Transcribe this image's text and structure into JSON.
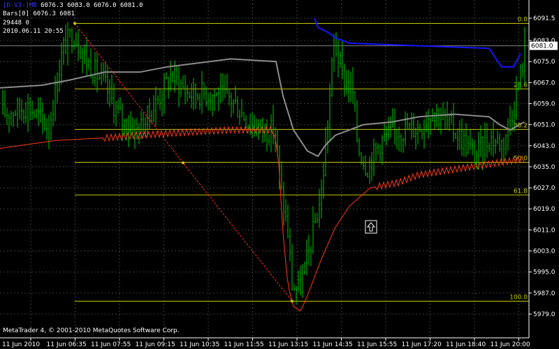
{
  "header": {
    "symbol": "[D-V3-]MB",
    "ohlc": "6076.3 6083.0 6076.0 6081.0",
    "bars_label": "Bars[0]",
    "bars_value": "6076.3 6081",
    "value_line": "29448 0",
    "datetime": "2010.06.11 20:55"
  },
  "footer": {
    "copyright": "MetaTrader 4, © 2001-2010 MetaQuotes Software Corp."
  },
  "current_price_label": "6081.0",
  "colors": {
    "background": "#000000",
    "grid": "#3c3c3c",
    "candles": "#00c800",
    "fibo": "#c8c800",
    "ma_gray": "#8c8c8c",
    "ma_blue": "#1515ff",
    "ma_red": "#ff3a1a",
    "zigzag": "#ff2a2a",
    "text": "#ffffff"
  },
  "icons": {
    "arrow_marker": "up-arrow-icon"
  },
  "chart_data": {
    "type": "candlestick",
    "price_axis_ticks": [
      "6091.5",
      "6083.0",
      "6075.0",
      "6067.0",
      "6059.0",
      "6051.0",
      "6043.0",
      "6035.0",
      "6027.0",
      "6019.0",
      "6011.0",
      "6003.0",
      "5995.0",
      "5987.0",
      "5979.0"
    ],
    "time_axis_ticks": [
      "11 Jun 2010",
      "11 Jun 06:35",
      "11 Jun 07:55",
      "11 Jun 09:15",
      "11 Jun 10:35",
      "11 Jun 11:55",
      "11 Jun 13:15",
      "11 Jun 14:35",
      "11 Jun 15:55",
      "11 Jun 17:20",
      "11 Jun 18:40",
      "11 Jun 20:00"
    ],
    "fibonacci_levels": [
      {
        "label": "0.0",
        "price": 6089.5
      },
      {
        "label": "23.6",
        "price": 6064.6
      },
      {
        "label": "38.2",
        "price": 6049.2
      },
      {
        "label": "50.0",
        "price": 6036.7
      },
      {
        "label": "61.8",
        "price": 6024.3
      },
      {
        "label": "100.0",
        "price": 5983.9
      }
    ],
    "fibo_anchor_high": 6089.5,
    "fibo_anchor_low": 5983.9,
    "current_price": 6081.0
  }
}
